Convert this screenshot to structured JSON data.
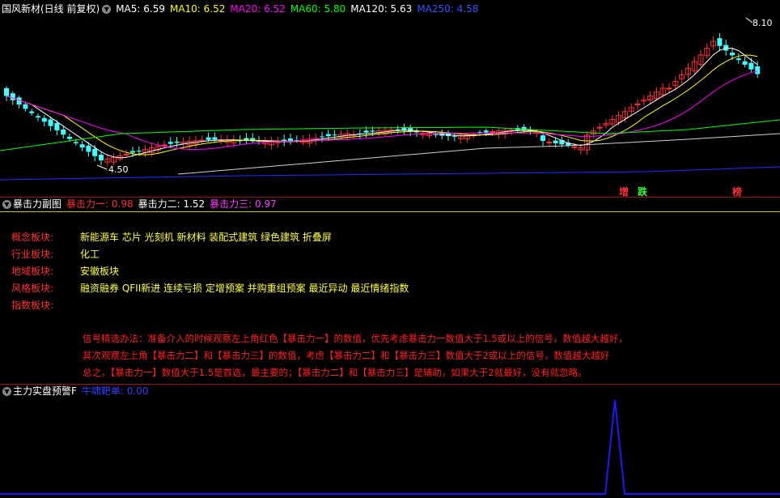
{
  "main_panel": {
    "title": "国风新材(日线 前复权)",
    "ma": [
      {
        "label": "MA5: 6.59",
        "color": "#ffffff"
      },
      {
        "label": "MA10: 6.52",
        "color": "#ffff00"
      },
      {
        "label": "MA20: 6.52",
        "color": "#ff00ff"
      },
      {
        "label": "MA60: 5.80",
        "color": "#00ff00"
      },
      {
        "label": "MA120: 5.63",
        "color": "#ffffff"
      },
      {
        "label": "MA250: 4.58",
        "color": "#3355ff"
      }
    ],
    "high_label": "8.10",
    "low_label": "4.50",
    "tag_zeng": "增",
    "tag_die": "跌",
    "tag_bang": "榜"
  },
  "sub_panel": {
    "title": "暴击力副图",
    "v1": "暴击力一: 0.98",
    "v2": "暴击力二: 1.52",
    "v3": "暴击力三: 0.97",
    "info": [
      {
        "label": "概念板块:",
        "value": "新能源车 芯片 光刻机 新材料 装配式建筑 绿色建筑 折叠屏"
      },
      {
        "label": "行业板块:",
        "value": "化工"
      },
      {
        "label": "地域板块:",
        "value": "安徽板块"
      },
      {
        "label": "风格板块:",
        "value": "融资融券 QFII新进 连续亏损 定增预案 并购重组预案 最近异动 最近情绪指数"
      },
      {
        "label": "指数板块:",
        "value": ""
      }
    ],
    "signal_lines": [
      "信号精选办法：准备介入的时候观察左上角红色【暴击力一】的数值，优先考虑暴击力一数值大于1.5或以上的信号，数值越大越好，",
      "其次观察左上角【暴击力二】和【暴击力三】的数值，考虑【暴击力二】和【暴击力三】数值大于2或以上的信号，数值越大越好",
      "总之，【暴击力一】数值大于1.5是首选，最主要的；【暴击力二】和【暴击力三】是辅助，如果大于2就最好，没有就忽略。"
    ]
  },
  "bottom_panel": {
    "title": "主力实盘预警F",
    "value": "牛啸靶单: 0.00"
  },
  "colors": {
    "up": "#ff3030",
    "down": "#40ffff",
    "ma250": "#2030ff",
    "spike": "#1a1aff"
  }
}
